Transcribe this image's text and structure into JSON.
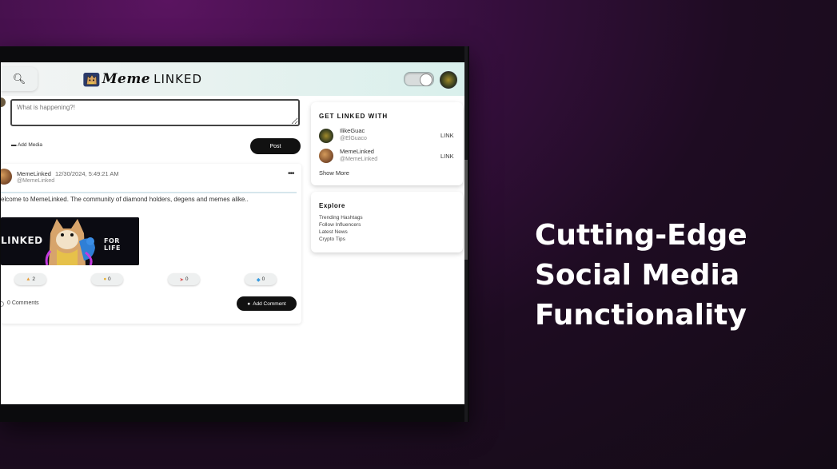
{
  "header": {
    "logo_text_1": "Meme",
    "logo_text_2": "LINKED"
  },
  "compose": {
    "placeholder": "What is happening?!",
    "add_media_label": "Add Media",
    "post_label": "Post"
  },
  "post": {
    "author": "MemeLinked",
    "datetime": "12/30/2024, 5:49:21 AM",
    "handle": "@MemeLinked",
    "text": "elcome to MemeLinked. The community of diamond holders, degens and memes alike..",
    "image_text_left": "LINKED",
    "image_text_right": "FOR LIFE",
    "reactions": [
      {
        "icon": "flame-icon",
        "count": "2"
      },
      {
        "icon": "lightbulb-icon",
        "count": "0"
      },
      {
        "icon": "rocket-icon",
        "count": "0"
      },
      {
        "icon": "diamond-icon",
        "count": "0"
      }
    ],
    "comments_label": "0 Comments",
    "add_comment_label": "Add Comment"
  },
  "get_linked": {
    "title": "GET LINKED WITH",
    "suggestions": [
      {
        "name": "IlikeGuac",
        "handle": "@ElGuaco",
        "action": "LINK"
      },
      {
        "name": "MemeLinked",
        "handle": "@MemeLinked",
        "action": "LINK"
      }
    ],
    "show_more": "Show More"
  },
  "explore": {
    "title": "Explore",
    "items": [
      "Trending Hashtags",
      "Follow Influencers",
      "Latest News",
      "Crypto Tips"
    ]
  },
  "headline": {
    "line1": "Cutting-Edge",
    "line2": "Social Media",
    "line3": "Functionality"
  },
  "colors": {
    "accent_button": "#111111",
    "background_purple": "#3a0f42"
  }
}
